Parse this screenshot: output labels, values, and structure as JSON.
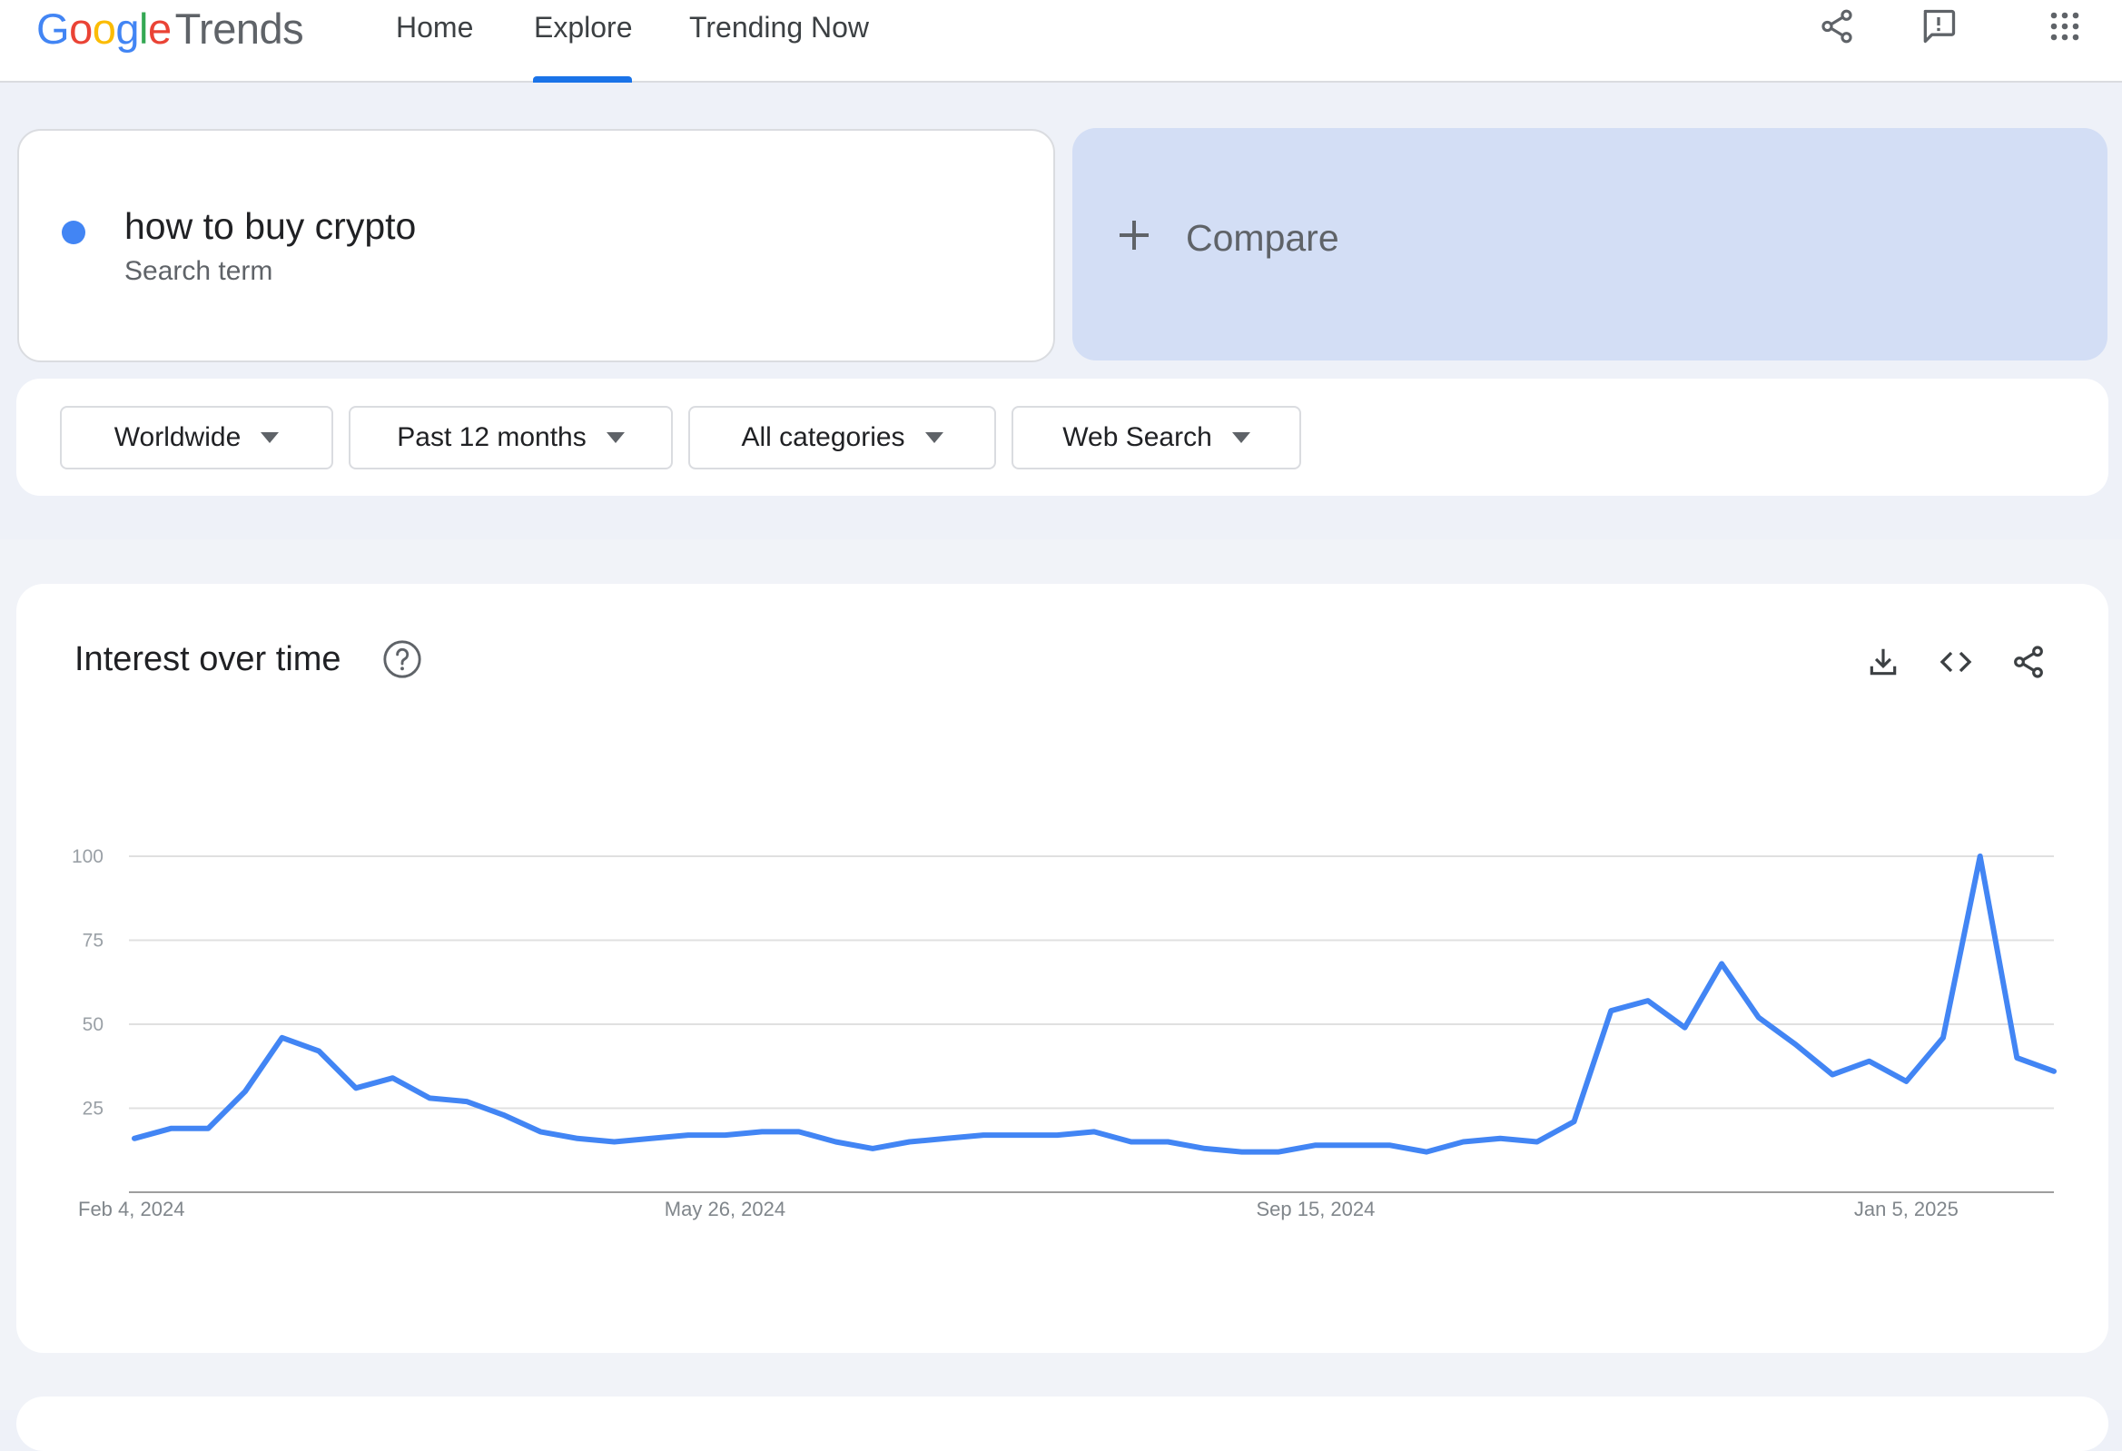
{
  "header": {
    "logo_letters": [
      "G",
      "o",
      "o",
      "g",
      "l",
      "e"
    ],
    "logo_product": "Trends",
    "tabs": [
      {
        "label": "Home"
      },
      {
        "label": "Explore"
      },
      {
        "label": "Trending Now"
      }
    ],
    "active_tab": "Explore",
    "icons": [
      "share-icon",
      "feedback-icon",
      "apps-icon"
    ]
  },
  "search": {
    "term": "how to buy crypto",
    "term_type": "Search term",
    "term_color": "#4285f4",
    "compare_label": "Compare"
  },
  "filters": {
    "region": "Worldwide",
    "time_range": "Past 12 months",
    "category": "All categories",
    "property": "Web Search"
  },
  "card": {
    "title": "Interest over time",
    "icons": [
      "help-icon",
      "download-icon",
      "embed-icon",
      "share-icon"
    ]
  },
  "colors": {
    "accent": "#1a73e8",
    "series": "#4285f4",
    "compare_bg": "#d3def5"
  },
  "chart_data": {
    "type": "line",
    "title": "Interest over time",
    "ylim": [
      0,
      100
    ],
    "y_ticks": [
      "100",
      "75",
      "50",
      "25"
    ],
    "x_tick_labels": [
      {
        "label": "Feb 4, 2024",
        "index": 0
      },
      {
        "label": "May 26, 2024",
        "index": 16
      },
      {
        "label": "Sep 15, 2024",
        "index": 32
      },
      {
        "label": "Jan 5, 2025",
        "index": 48
      }
    ],
    "grid": true,
    "series": [
      {
        "color": "#4285f4",
        "values": [
          16,
          19,
          19,
          30,
          46,
          42,
          31,
          34,
          28,
          27,
          23,
          18,
          16,
          15,
          16,
          17,
          17,
          18,
          18,
          15,
          13,
          15,
          16,
          17,
          17,
          17,
          18,
          15,
          15,
          13,
          12,
          12,
          14,
          14,
          14,
          12,
          15,
          16,
          15,
          21,
          54,
          57,
          49,
          68,
          52,
          44,
          35,
          39,
          33,
          46,
          100,
          40,
          36
        ]
      }
    ]
  }
}
